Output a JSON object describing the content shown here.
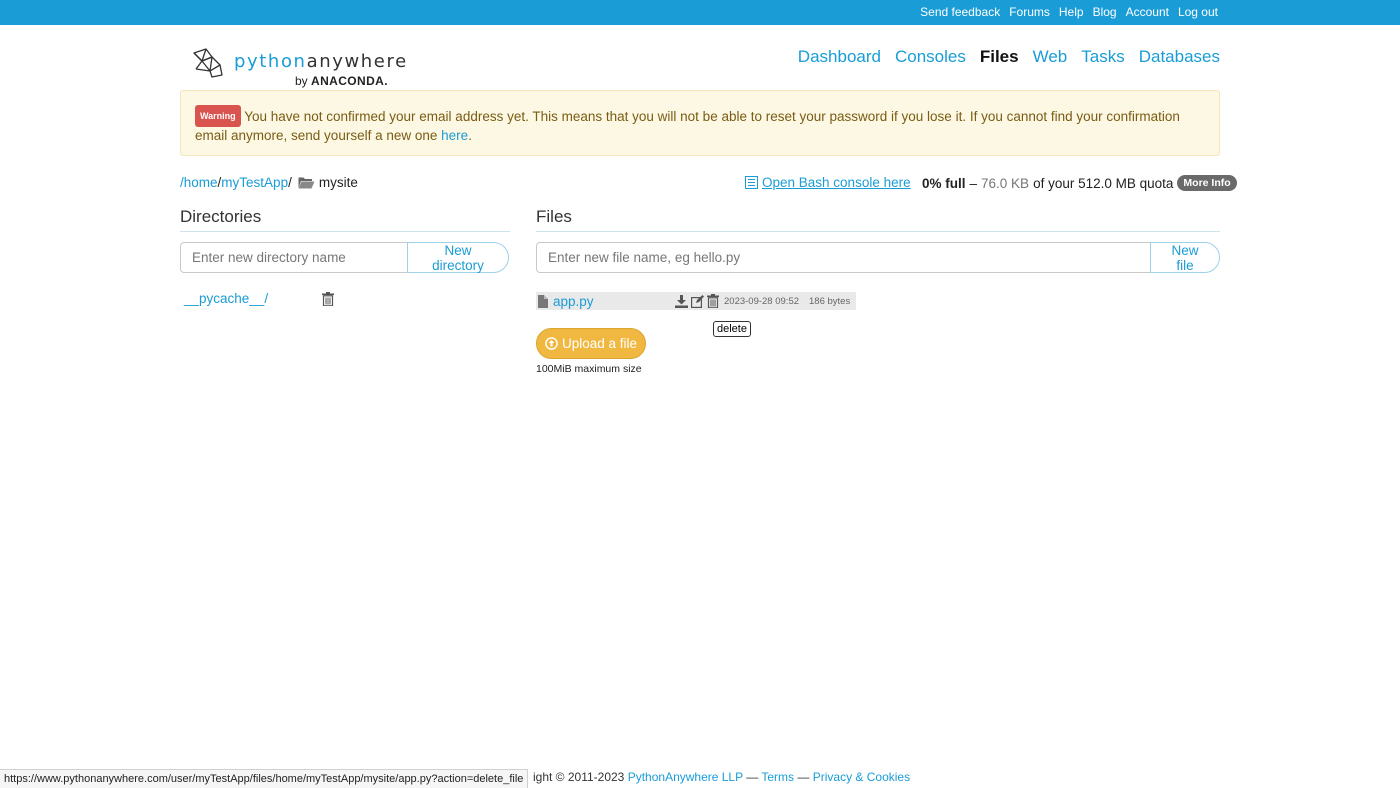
{
  "topbar": {
    "links": [
      "Send feedback",
      "Forums",
      "Help",
      "Blog",
      "Account",
      "Log out"
    ],
    "color": "#1a9cd6"
  },
  "logo": {
    "text_a": "python",
    "text_b": "anywhere",
    "by": "by",
    "brand": "ANACONDA."
  },
  "nav": {
    "items": [
      "Dashboard",
      "Consoles",
      "Files",
      "Web",
      "Tasks",
      "Databases"
    ],
    "active": "Files"
  },
  "alert": {
    "badge": "Warning",
    "text": "You have not confirmed your email address yet. This means that you will not be able to reset your password if you lose it. If you cannot find your confirmation email anymore, send yourself a new one",
    "link": "here",
    "end": "."
  },
  "breadcrumb": {
    "root": "/home",
    "sep1": "/",
    "user": "myTestApp",
    "sep2": "/",
    "current": "mysite"
  },
  "bash_link": "Open Bash console here",
  "quota": {
    "percent": "0% full",
    "dash": "–",
    "used": "76.0 KB",
    "of": "of your 512.0 MB quota",
    "more": "More Info"
  },
  "directories": {
    "title": "Directories",
    "placeholder": "Enter new directory name",
    "button": "New directory",
    "items": [
      "__pycache__/"
    ]
  },
  "files": {
    "title": "Files",
    "placeholder": "Enter new file name, eg hello.py",
    "button": "New file",
    "items": [
      {
        "name": "app.py",
        "modified": "2023-09-28 09:52",
        "size": "186 bytes"
      }
    ],
    "tooltip": "delete"
  },
  "upload": {
    "label": "Upload a file",
    "note": "100MiB maximum size"
  },
  "footer": {
    "prefix": "ight © 2011-2023",
    "company": "PythonAnywhere LLP",
    "sep": "—",
    "terms": "Terms",
    "privacy": "Privacy & Cookies"
  },
  "status_url": "https://www.pythonanywhere.com/user/myTestApp/files/home/myTestApp/mysite/app.py?action=delete_file"
}
